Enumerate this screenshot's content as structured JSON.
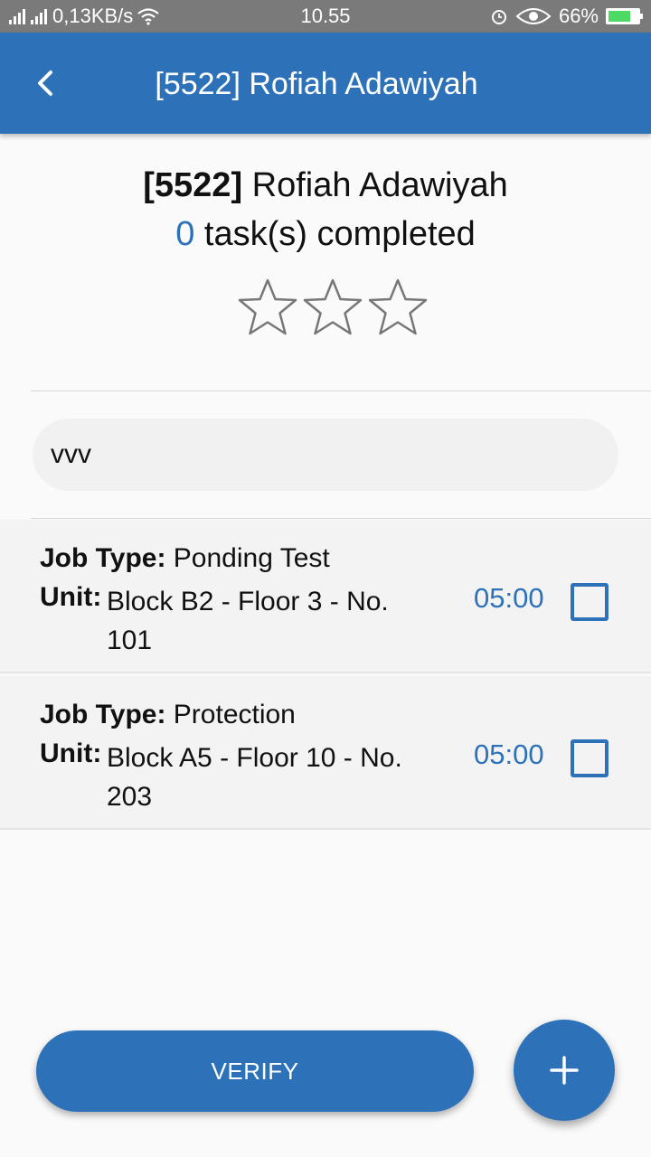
{
  "status_bar": {
    "network_speed": "0,13KB/s",
    "time": "10.55",
    "battery": "66%",
    "icons": [
      "signal-icon",
      "wifi-icon",
      "alarm-icon",
      "eye-icon",
      "battery-icon"
    ]
  },
  "app_bar": {
    "title": "[5522] Rofiah Adawiyah",
    "back_icon": "back-arrow-icon"
  },
  "employee": {
    "id": "[5522]",
    "name": "Rofiah Adawiyah",
    "completed_count": "0",
    "completed_label": "task(s) completed",
    "rating": 0,
    "max_rating": 3
  },
  "search": {
    "value": "vvv"
  },
  "tasks": [
    {
      "job_type_label": "Job Type:",
      "job_type": "Ponding Test",
      "unit_label": "Unit:",
      "unit": "Block B2 - Floor 3 - No. 101",
      "time": "05:00",
      "checked": false
    },
    {
      "job_type_label": "Job Type:",
      "job_type": "Protection",
      "unit_label": "Unit:",
      "unit": "Block A5 - Floor 10 - No. 203",
      "time": "05:00",
      "checked": false
    }
  ],
  "actions": {
    "verify_label": "VERIFY",
    "add_icon": "plus-icon"
  },
  "colors": {
    "primary": "#2d72b9",
    "status_bar": "#7a7a7a",
    "background": "#fafafa",
    "row_background": "#f3f3f3"
  }
}
